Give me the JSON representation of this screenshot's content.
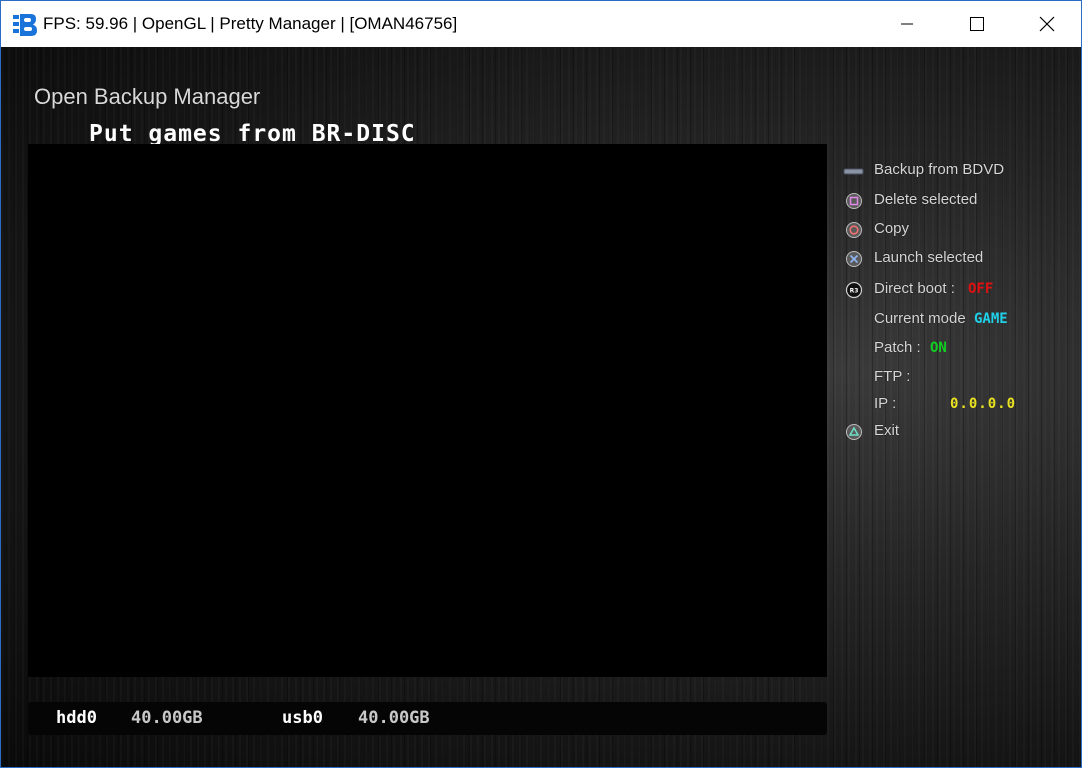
{
  "window": {
    "title": "FPS: 59.96 | OpenGL | Pretty Manager | [OMAN46756]",
    "app_icon": "rpcs3-icon",
    "controls": [
      "minimize-icon",
      "maximize-icon",
      "close-icon"
    ]
  },
  "app": {
    "title": "Open Backup Manager",
    "subtitle": "Put games from BR-DISC"
  },
  "menu": {
    "backup": {
      "icon": "select-button-icon",
      "label": "Backup from BDVD"
    },
    "delete": {
      "icon": "square-button-icon",
      "label": "Delete selected"
    },
    "copy": {
      "icon": "circle-button-icon",
      "label": "Copy"
    },
    "launch": {
      "icon": "cross-button-icon",
      "label": "Launch selected"
    },
    "direct_boot": {
      "icon": "r3-button-icon",
      "label": "Direct boot :",
      "value": "OFF"
    },
    "current_mode": {
      "label": "Current mode",
      "value": "GAME"
    },
    "patch": {
      "label": "Patch :",
      "value": "ON"
    },
    "ftp": {
      "label": "FTP :"
    },
    "ip": {
      "label": "IP :",
      "value": "0.0.0.0"
    },
    "exit": {
      "icon": "triangle-button-icon",
      "label": "Exit"
    }
  },
  "status": {
    "hdd_label": "hdd0",
    "hdd_value": "40.00GB",
    "usb_label": "usb0",
    "usb_value": "40.00GB"
  },
  "colors": {
    "off": "#e01010",
    "game": "#1fd0e8",
    "on": "#10d020",
    "ip": "#e8e020"
  }
}
